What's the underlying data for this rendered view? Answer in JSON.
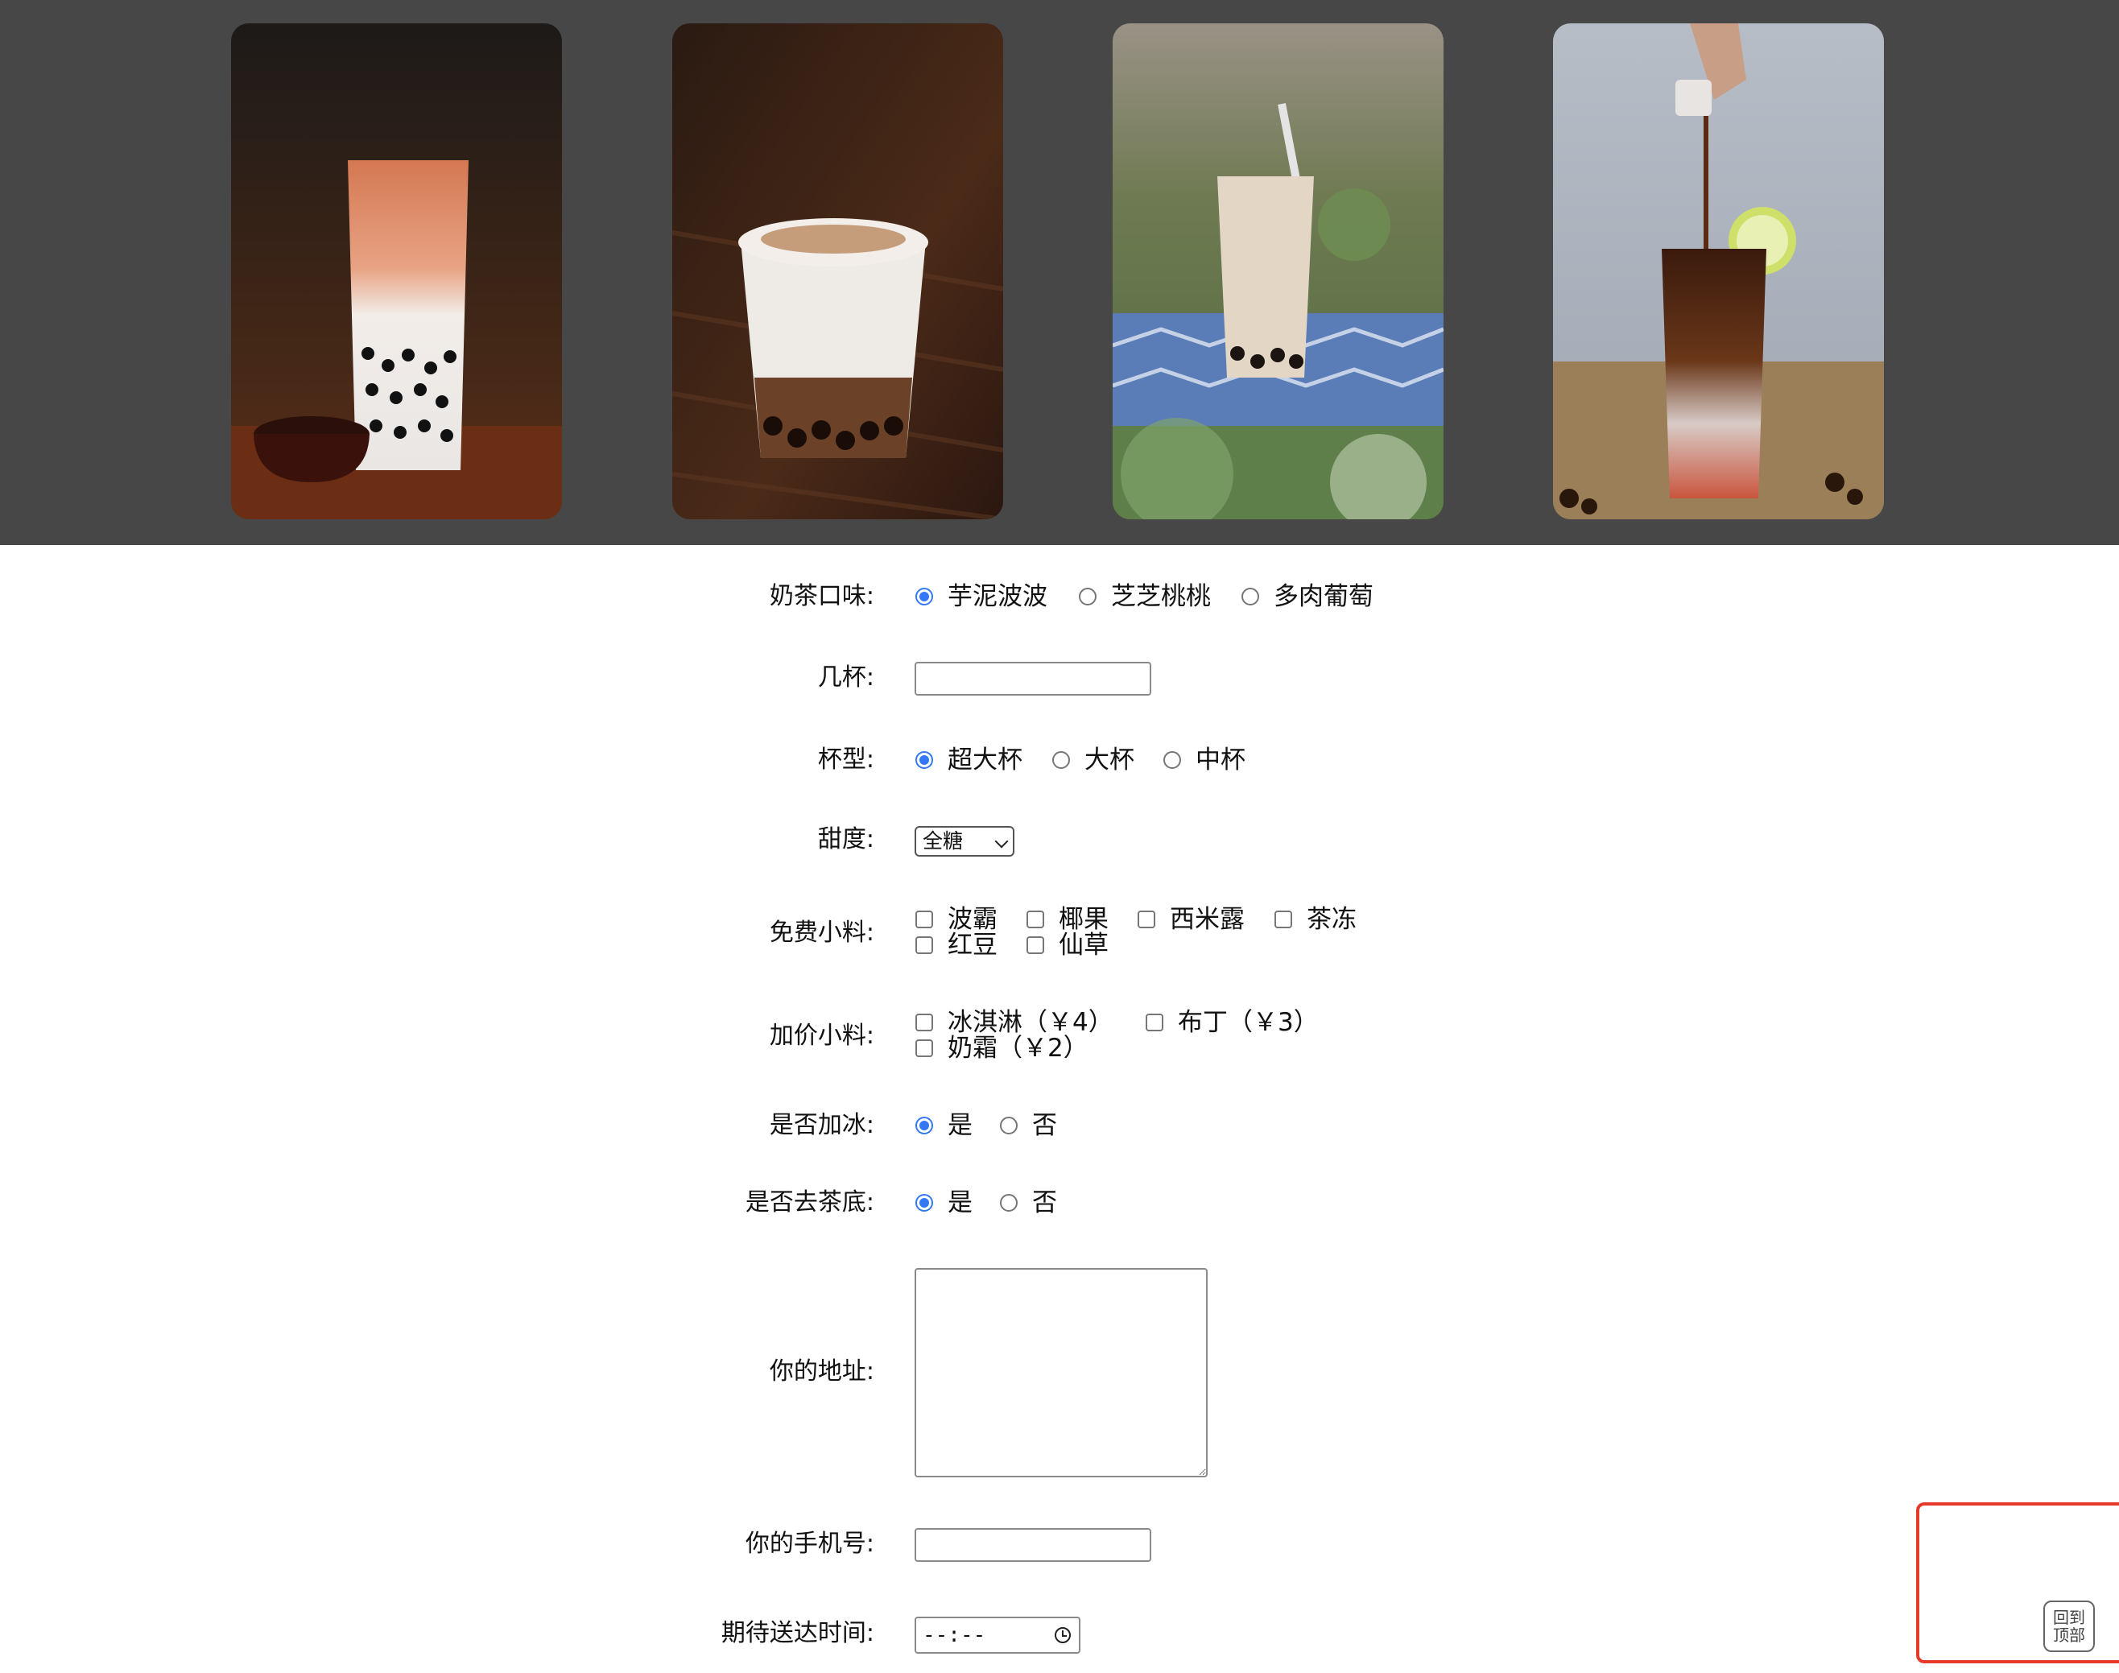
{
  "banner": {
    "photos": [
      {
        "alt": "milk-tea-boba-layered"
      },
      {
        "alt": "brown-sugar-boba-cup"
      },
      {
        "alt": "boba-milk-tea-outdoor"
      },
      {
        "alt": "iced-tea-lemon-pour"
      }
    ]
  },
  "form": {
    "flavor": {
      "label": "奶茶口味:",
      "options": [
        "芋泥波波",
        "芝芝桃桃",
        "多肉葡萄"
      ],
      "selected": "芋泥波波"
    },
    "cups": {
      "label": "几杯:",
      "value": ""
    },
    "size": {
      "label": "杯型:",
      "options": [
        "超大杯",
        "大杯",
        "中杯"
      ],
      "selected": "超大杯"
    },
    "sweetness": {
      "label": "甜度:",
      "selected": "全糖"
    },
    "free_toppings": {
      "label": "免费小料:",
      "options": [
        "波霸",
        "椰果",
        "西米露",
        "茶冻",
        "红豆",
        "仙草"
      ]
    },
    "paid_toppings": {
      "label": "加价小料:",
      "options": [
        "冰淇淋（￥4）",
        "布丁（￥3）",
        "奶霜（￥2）"
      ]
    },
    "ice": {
      "label": "是否加冰:",
      "options": [
        "是",
        "否"
      ],
      "selected": "是"
    },
    "tea_base": {
      "label": "是否去茶底:",
      "options": [
        "是",
        "否"
      ],
      "selected": "是"
    },
    "address": {
      "label": "你的地址:",
      "value": ""
    },
    "phone": {
      "label": "你的手机号:",
      "value": ""
    },
    "delivery_time": {
      "label": "期待送达时间:",
      "value": "--:--"
    }
  },
  "back_to_top": {
    "label": "回到顶部"
  },
  "colors": {
    "banner_bg": "#474747",
    "accent": "#3478f6",
    "highlight": "#e53a2a"
  }
}
